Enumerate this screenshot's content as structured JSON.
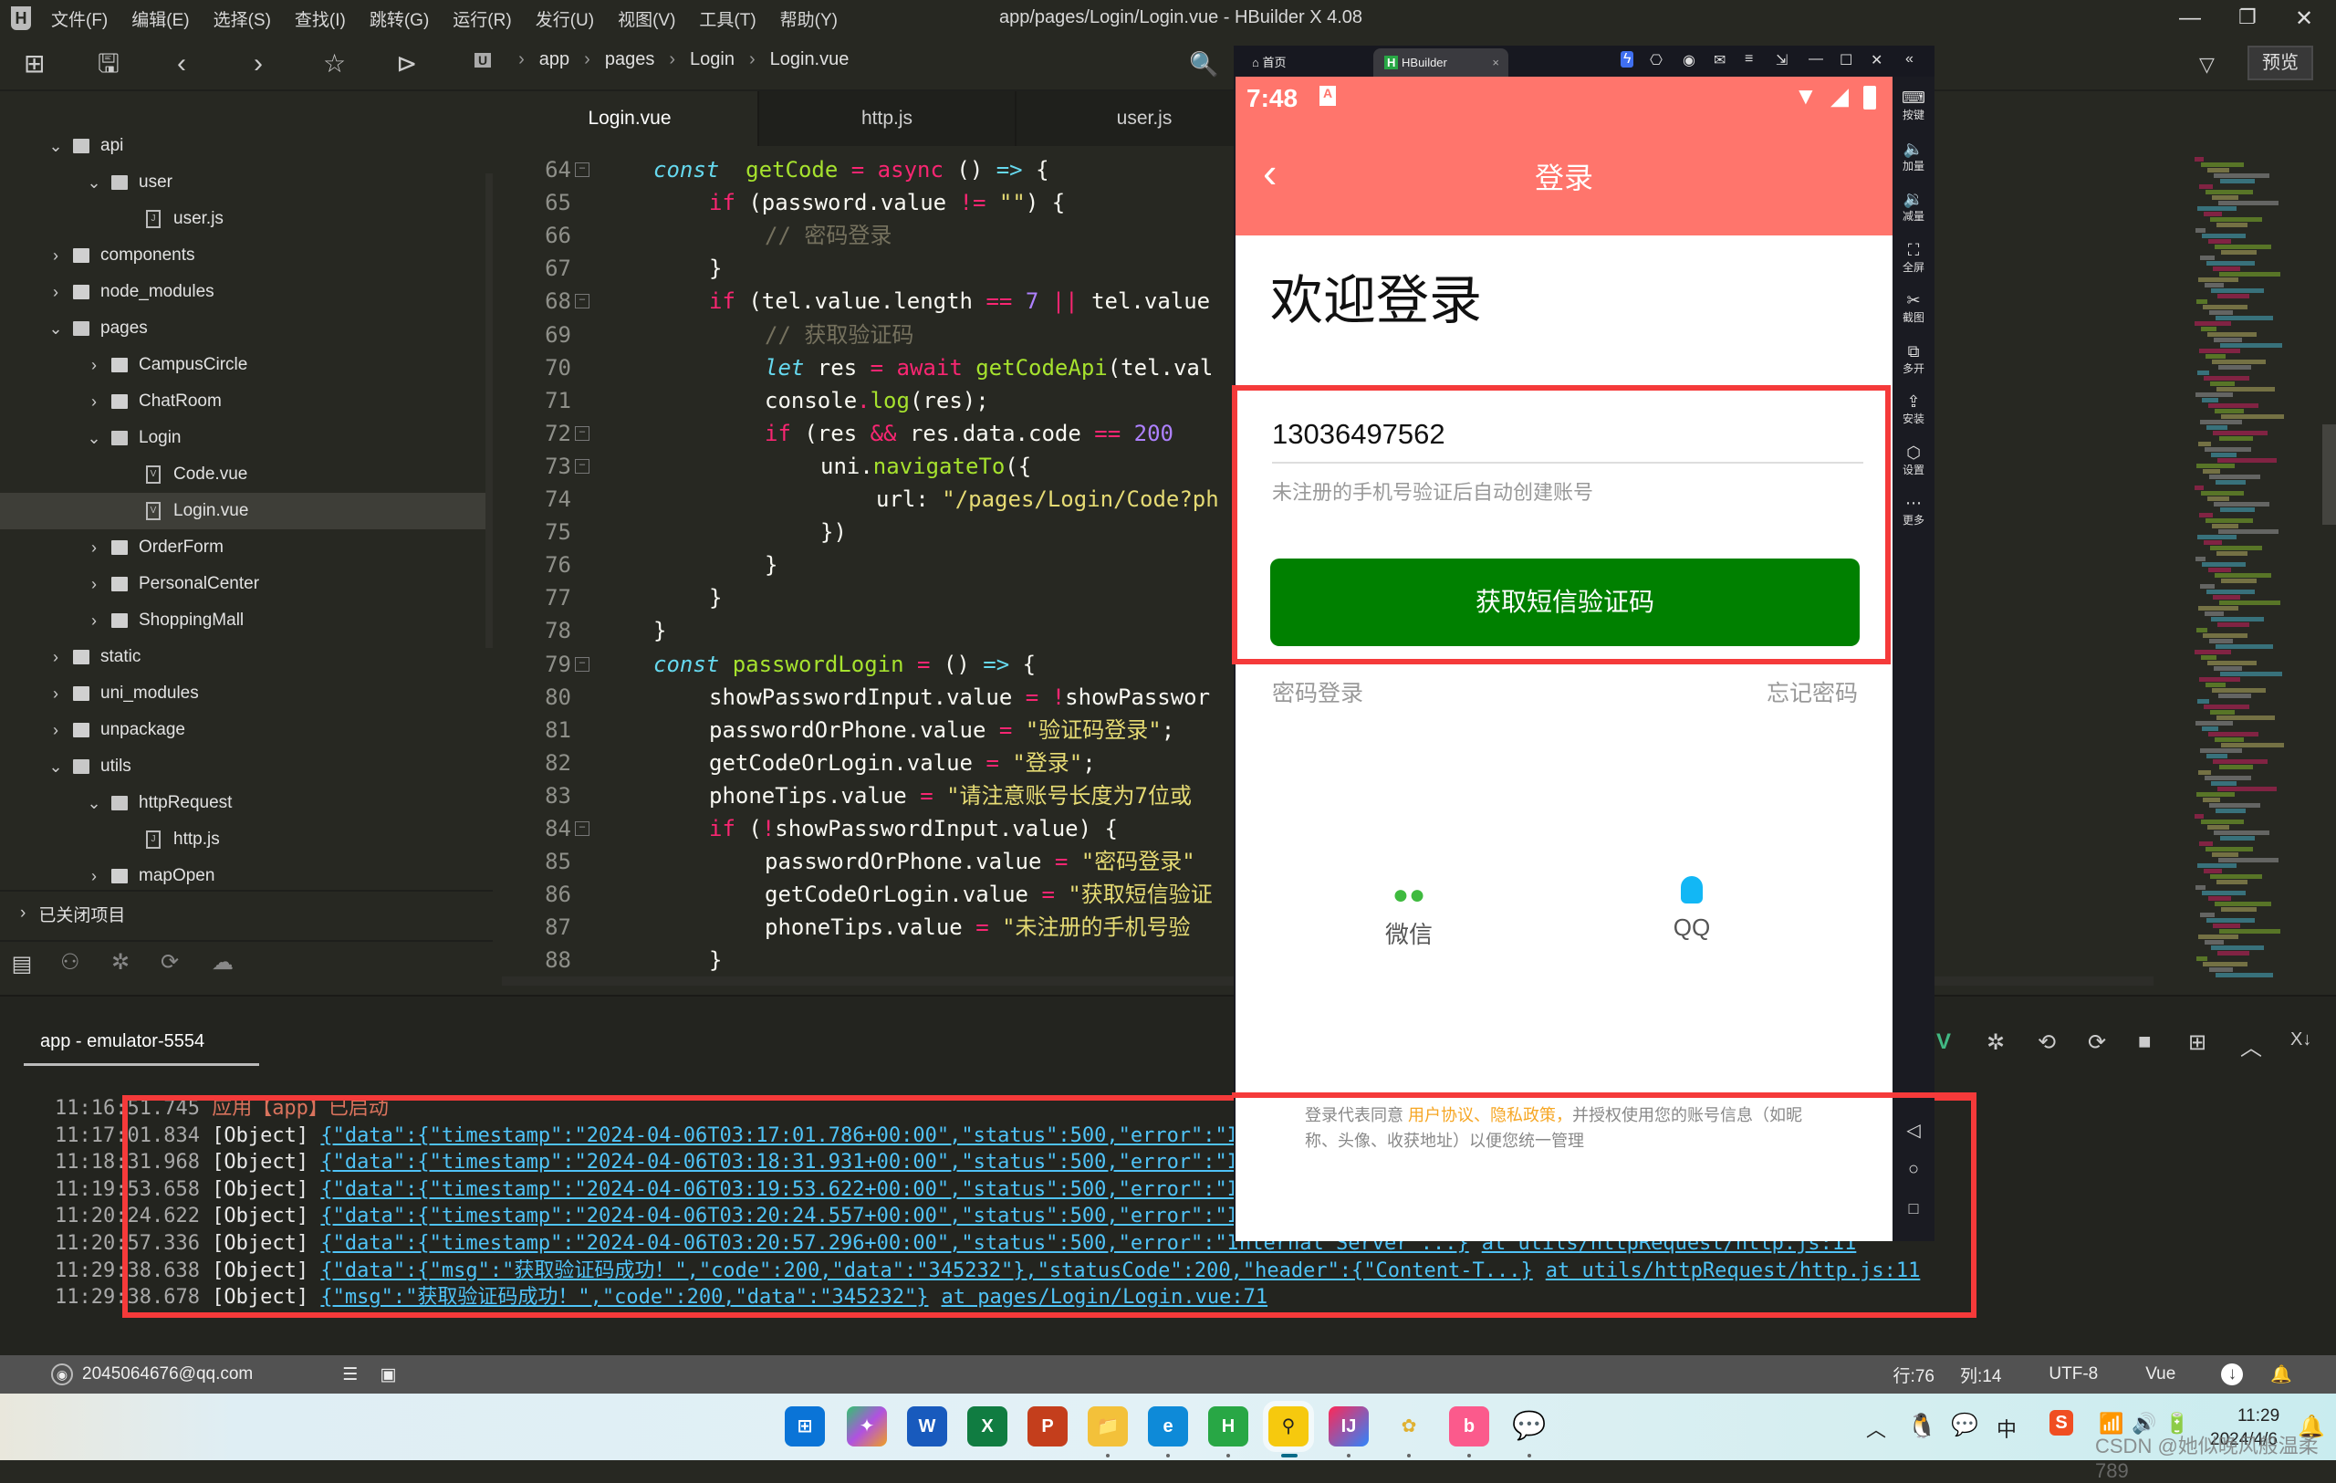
{
  "window": {
    "title": "app/pages/Login/Login.vue - HBuilder X 4.08",
    "menus": [
      "文件(F)",
      "编辑(E)",
      "选择(S)",
      "查找(I)",
      "跳转(G)",
      "运行(R)",
      "发行(U)",
      "视图(V)",
      "工具(T)",
      "帮助(Y)"
    ]
  },
  "toolbar": {
    "breadcrumb": [
      "app",
      "pages",
      "Login",
      "Login.vue"
    ],
    "preview_label": "预览"
  },
  "sidebar": {
    "tree": [
      {
        "label": "api",
        "type": "folder",
        "expanded": true,
        "depth": 0
      },
      {
        "label": "user",
        "type": "folder",
        "expanded": true,
        "depth": 1
      },
      {
        "label": "user.js",
        "type": "js",
        "depth": 2
      },
      {
        "label": "components",
        "type": "folder",
        "expanded": false,
        "depth": 0
      },
      {
        "label": "node_modules",
        "type": "folder",
        "expanded": false,
        "depth": 0
      },
      {
        "label": "pages",
        "type": "folder",
        "expanded": true,
        "depth": 0
      },
      {
        "label": "CampusCircle",
        "type": "folder",
        "expanded": false,
        "depth": 1
      },
      {
        "label": "ChatRoom",
        "type": "folder",
        "expanded": false,
        "depth": 1
      },
      {
        "label": "Login",
        "type": "folder",
        "expanded": true,
        "depth": 1
      },
      {
        "label": "Code.vue",
        "type": "vue",
        "depth": 2
      },
      {
        "label": "Login.vue",
        "type": "vue",
        "depth": 2,
        "selected": true
      },
      {
        "label": "OrderForm",
        "type": "folder",
        "expanded": false,
        "depth": 1
      },
      {
        "label": "PersonalCenter",
        "type": "folder",
        "expanded": false,
        "depth": 1
      },
      {
        "label": "ShoppingMall",
        "type": "folder",
        "expanded": false,
        "depth": 1
      },
      {
        "label": "static",
        "type": "folder",
        "expanded": false,
        "depth": 0
      },
      {
        "label": "uni_modules",
        "type": "folder",
        "expanded": false,
        "depth": 0
      },
      {
        "label": "unpackage",
        "type": "folder",
        "expanded": false,
        "depth": 0
      },
      {
        "label": "utils",
        "type": "folder",
        "expanded": true,
        "depth": 0
      },
      {
        "label": "httpRequest",
        "type": "folder",
        "expanded": true,
        "depth": 1
      },
      {
        "label": "http.js",
        "type": "js",
        "depth": 2
      },
      {
        "label": "mapOpen",
        "type": "folder",
        "expanded": false,
        "depth": 1
      }
    ],
    "closed_projects": "已关闭项目"
  },
  "editor": {
    "tabs": [
      "Login.vue",
      "http.js",
      "user.js"
    ],
    "active_tab": 0,
    "lines": [
      {
        "n": "64",
        "fold": true,
        "indent": 0,
        "tokens": [
          [
            "kc",
            "const"
          ],
          [
            "",
            "  "
          ],
          [
            "fn",
            "getCode"
          ],
          [
            "",
            " "
          ],
          [
            "op",
            "="
          ],
          [
            "",
            " "
          ],
          [
            "kw",
            "async"
          ],
          [
            "",
            " () "
          ],
          [
            "ar",
            "=>"
          ],
          [
            "",
            " {"
          ]
        ]
      },
      {
        "n": "65",
        "indent": 1,
        "tokens": [
          [
            "kw",
            "if"
          ],
          [
            "",
            " (password.value "
          ],
          [
            "op",
            "!="
          ],
          [
            "",
            " "
          ],
          [
            "st",
            "\"\""
          ],
          [
            "",
            ") {"
          ]
        ]
      },
      {
        "n": "66",
        "indent": 2,
        "tokens": [
          [
            "cm",
            "// 密码登录"
          ]
        ]
      },
      {
        "n": "67",
        "indent": 1,
        "tokens": [
          [
            "",
            "}"
          ]
        ]
      },
      {
        "n": "68",
        "fold": true,
        "indent": 1,
        "tokens": [
          [
            "kw",
            "if"
          ],
          [
            "",
            " (tel.value.length "
          ],
          [
            "op",
            "=="
          ],
          [
            "",
            " "
          ],
          [
            "nm",
            "7"
          ],
          [
            "",
            " "
          ],
          [
            "op",
            "||"
          ],
          [
            "",
            " tel.value"
          ]
        ]
      },
      {
        "n": "69",
        "indent": 2,
        "tokens": [
          [
            "cm",
            "// 获取验证码"
          ]
        ]
      },
      {
        "n": "70",
        "indent": 2,
        "tokens": [
          [
            "kc",
            "let"
          ],
          [
            "",
            " res "
          ],
          [
            "op",
            "="
          ],
          [
            "",
            " "
          ],
          [
            "kw",
            "await"
          ],
          [
            "",
            " "
          ],
          [
            "fn",
            "getCodeApi"
          ],
          [
            "",
            "(tel.val"
          ]
        ]
      },
      {
        "n": "71",
        "indent": 2,
        "tokens": [
          [
            "",
            "console"
          ],
          [
            "op",
            "."
          ],
          [
            "fn",
            "log"
          ],
          [
            "",
            "(res);"
          ]
        ]
      },
      {
        "n": "72",
        "fold": true,
        "indent": 2,
        "tokens": [
          [
            "kw",
            "if"
          ],
          [
            "",
            " (res "
          ],
          [
            "op",
            "&&"
          ],
          [
            "",
            " res.data.code "
          ],
          [
            "op",
            "=="
          ],
          [
            "",
            " "
          ],
          [
            "nm",
            "200"
          ],
          [
            ")"
          ]
        ]
      },
      {
        "n": "73",
        "fold": true,
        "indent": 3,
        "tokens": [
          [
            "",
            "uni."
          ],
          [
            "fn",
            "navigateTo"
          ],
          [
            "",
            "({"
          ]
        ]
      },
      {
        "n": "74",
        "indent": 4,
        "tokens": [
          [
            "",
            "url: "
          ],
          [
            "st",
            "\"/pages/Login/Code?ph"
          ]
        ]
      },
      {
        "n": "75",
        "indent": 3,
        "tokens": [
          [
            "",
            "})"
          ]
        ]
      },
      {
        "n": "76",
        "indent": 2,
        "tokens": [
          [
            "",
            "}"
          ]
        ]
      },
      {
        "n": "77",
        "indent": 1,
        "tokens": [
          [
            "",
            "}"
          ]
        ]
      },
      {
        "n": "78",
        "indent": 0,
        "tokens": [
          [
            "",
            "}"
          ]
        ]
      },
      {
        "n": "79",
        "fold": true,
        "indent": 0,
        "tokens": [
          [
            "kc",
            "const"
          ],
          [
            "",
            " "
          ],
          [
            "fn",
            "passwordLogin"
          ],
          [
            "",
            " "
          ],
          [
            "op",
            "="
          ],
          [
            "",
            " () "
          ],
          [
            "ar",
            "=>"
          ],
          [
            "",
            " {"
          ]
        ]
      },
      {
        "n": "80",
        "indent": 1,
        "tokens": [
          [
            "",
            "showPasswordInput.value "
          ],
          [
            "op",
            "="
          ],
          [
            "",
            " "
          ],
          [
            "op",
            "!"
          ],
          [
            "",
            "showPasswor"
          ]
        ]
      },
      {
        "n": "81",
        "indent": 1,
        "tokens": [
          [
            "",
            "passwordOrPhone.value "
          ],
          [
            "op",
            "="
          ],
          [
            "",
            " "
          ],
          [
            "st",
            "\"验证码登录\""
          ],
          [
            "",
            ";"
          ]
        ]
      },
      {
        "n": "82",
        "indent": 1,
        "tokens": [
          [
            "",
            "getCodeOrLogin.value "
          ],
          [
            "op",
            "="
          ],
          [
            "",
            " "
          ],
          [
            "st",
            "\"登录\""
          ],
          [
            "",
            ";"
          ]
        ]
      },
      {
        "n": "83",
        "indent": 1,
        "tokens": [
          [
            "",
            "phoneTips.value "
          ],
          [
            "op",
            "="
          ],
          [
            "",
            " "
          ],
          [
            "st",
            "\"请注意账号长度为7位或"
          ]
        ]
      },
      {
        "n": "84",
        "fold": true,
        "indent": 1,
        "tokens": [
          [
            "kw",
            "if"
          ],
          [
            "",
            " ("
          ],
          [
            "op",
            "!"
          ],
          [
            "",
            "showPasswordInput.value) {"
          ]
        ]
      },
      {
        "n": "85",
        "indent": 2,
        "tokens": [
          [
            "",
            "passwordOrPhone.value "
          ],
          [
            "op",
            "="
          ],
          [
            "",
            " "
          ],
          [
            "st",
            "\"密码登录\""
          ]
        ]
      },
      {
        "n": "86",
        "indent": 2,
        "tokens": [
          [
            "",
            "getCodeOrLogin.value "
          ],
          [
            "op",
            "="
          ],
          [
            "",
            " "
          ],
          [
            "st",
            "\"获取短信验证"
          ]
        ]
      },
      {
        "n": "87",
        "indent": 2,
        "tokens": [
          [
            "",
            "phoneTips.value "
          ],
          [
            "op",
            "="
          ],
          [
            "",
            " "
          ],
          [
            "st",
            "\"未注册的手机号验"
          ]
        ]
      },
      {
        "n": "88",
        "indent": 1,
        "tokens": [
          [
            "",
            "}"
          ]
        ]
      }
    ]
  },
  "console": {
    "tab_label": "app - emulator-5554",
    "logs": [
      {
        "time": "11:16:51.745",
        "type": "sys",
        "text": "应用【app】已启动"
      },
      {
        "time": "11:17:01.834",
        "obj": "[Object]",
        "json": "{\"data\":{\"timestamp\":\"2024-04-06T03:17:01.786+00:00\",\"status\":500,\"error\":\"I"
      },
      {
        "time": "11:18:31.968",
        "obj": "[Object]",
        "json": "{\"data\":{\"timestamp\":\"2024-04-06T03:18:31.931+00:00\",\"status\":500,\"error\":\"I"
      },
      {
        "time": "11:19:53.658",
        "obj": "[Object]",
        "json": "{\"data\":{\"timestamp\":\"2024-04-06T03:19:53.622+00:00\",\"status\":500,\"error\":\"I"
      },
      {
        "time": "11:20:24.622",
        "obj": "[Object]",
        "json": "{\"data\":{\"timestamp\":\"2024-04-06T03:20:24.557+00:00\",\"status\":500,\"error\":\"I"
      },
      {
        "time": "11:20:57.336",
        "obj": "[Object]",
        "json": "{\"data\":{\"timestamp\":\"2024-04-06T03:20:57.296+00:00\",\"status\":500,\"error\":\"Internal Server ...}",
        "at": "at utils/httpRequest/http.js:11"
      },
      {
        "time": "11:29:38.638",
        "obj": "[Object]",
        "json": "{\"data\":{\"msg\":\"获取验证码成功！\",\"code\":200,\"data\":\"345232\"},\"statusCode\":200,\"header\":{\"Content-T...}",
        "at": "at utils/httpRequest/http.js:11"
      },
      {
        "time": "11:29:38.678",
        "obj": "[Object]",
        "json": "{\"msg\":\"获取验证码成功！\",\"code\":200,\"data\":\"345232\"}",
        "at": "at pages/Login/Login.vue:71"
      }
    ]
  },
  "statusbar": {
    "user": "2045064676@qq.com",
    "line": "行:76",
    "col": "列:14",
    "encoding": "UTF-8",
    "language": "Vue"
  },
  "emulator": {
    "home_tab": "首页",
    "app_tab": "HBuilder",
    "side_buttons": [
      {
        "icon": "keyboard-icon",
        "glyph": "⌨",
        "label": "按键"
      },
      {
        "icon": "volume-up-icon",
        "glyph": "🔈",
        "label": "加量"
      },
      {
        "icon": "volume-down-icon",
        "glyph": "🔉",
        "label": "减量"
      },
      {
        "icon": "fullscreen-icon",
        "glyph": "⛶",
        "label": "全屏"
      },
      {
        "icon": "scissors-icon",
        "glyph": "✂",
        "label": "截图"
      },
      {
        "icon": "multi-open-icon",
        "glyph": "⧉",
        "label": "多开"
      },
      {
        "icon": "apk-install-icon",
        "glyph": "⇪",
        "label": "安装"
      },
      {
        "icon": "settings-icon",
        "glyph": "⬡",
        "label": "设置"
      },
      {
        "icon": "more-icon",
        "glyph": "⋯",
        "label": "更多"
      }
    ]
  },
  "phone": {
    "time": "7:48",
    "nav_title": "登录",
    "welcome": "欢迎登录",
    "phone_number": "13036497562",
    "tip": "未注册的手机号验证后自动创建账号",
    "sms_button": "获取短信验证码",
    "password_login": "密码登录",
    "forgot_password": "忘记密码",
    "social": [
      {
        "label": "微信",
        "icon": "wechat-icon",
        "color": "#3fba3f"
      },
      {
        "label": "QQ",
        "icon": "qq-icon",
        "color": "#12b7f5"
      }
    ],
    "agreement_prefix": "登录代表同意 ",
    "agreement_links": "用户协议、隐私政策，",
    "agreement_suffix": "并授权使用您的账号信息（如昵称、头像、收获地址）以便您统一管理",
    "colors": {
      "header": "#ff756c",
      "button": "#008000",
      "link": "#f6a623"
    }
  },
  "taskbar": {
    "clock_time": "11:29",
    "clock_date": "2024/4/6",
    "ime": "中",
    "watermark": "CSDN @她似晚风般温柔789"
  }
}
